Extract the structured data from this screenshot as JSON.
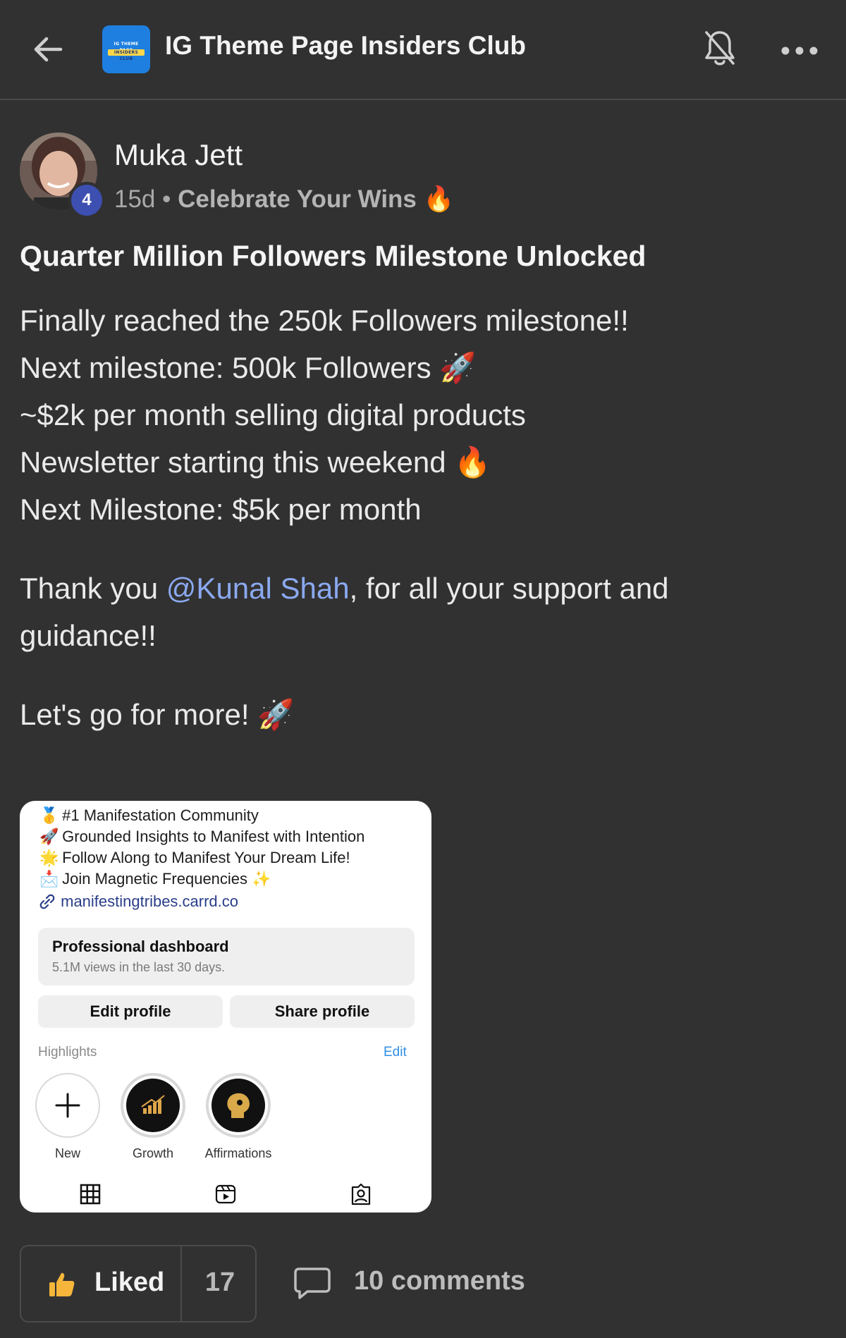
{
  "header": {
    "group_title": "IG Theme Page Insiders Club",
    "logo_line1": "IG THEME PAGE",
    "logo_line2": "INSIDERS CLUB"
  },
  "author": {
    "name": "Muka Jett",
    "level": "4",
    "age": "15d",
    "separator": "•",
    "category": "Celebrate Your Wins 🔥"
  },
  "post": {
    "title": "Quarter Million Followers Milestone Unlocked",
    "lines": [
      "Finally reached the 250k Followers milestone!!",
      "Next milestone: 500k Followers 🚀",
      "~$2k per month selling digital products",
      "Newsletter starting this weekend 🔥",
      "Next Milestone: $5k per month"
    ],
    "thanks_prefix": "Thank you ",
    "mention": "@Kunal Shah",
    "thanks_suffix": ", for all your support and",
    "thanks_line2": "guidance!!",
    "closing": "Let's go for more! 🚀"
  },
  "screenshot": {
    "bio": [
      {
        "emoji": "🥇",
        "text": "#1 Manifestation Community"
      },
      {
        "emoji": "🚀",
        "text": "Grounded Insights to Manifest with Intention"
      },
      {
        "emoji": "🌟",
        "text": "Follow Along to Manifest Your Dream Life!"
      },
      {
        "emoji": "📩",
        "text": "Join Magnetic Frequencies ✨"
      }
    ],
    "link": "manifestingtribes.carrd.co",
    "dashboard_title": "Professional dashboard",
    "dashboard_sub": "5.1M views in the last 30 days.",
    "edit_profile": "Edit profile",
    "share_profile": "Share profile",
    "highlights_label": "Highlights",
    "highlights_edit": "Edit",
    "highlights": [
      "New",
      "Growth",
      "Affirmations"
    ]
  },
  "actions": {
    "liked_label": "Liked",
    "like_count": "17",
    "comments_label": "10 comments"
  },
  "colors": {
    "background": "#313131",
    "mention": "#8ba9f0",
    "level_badge": "#3d4fb0"
  }
}
